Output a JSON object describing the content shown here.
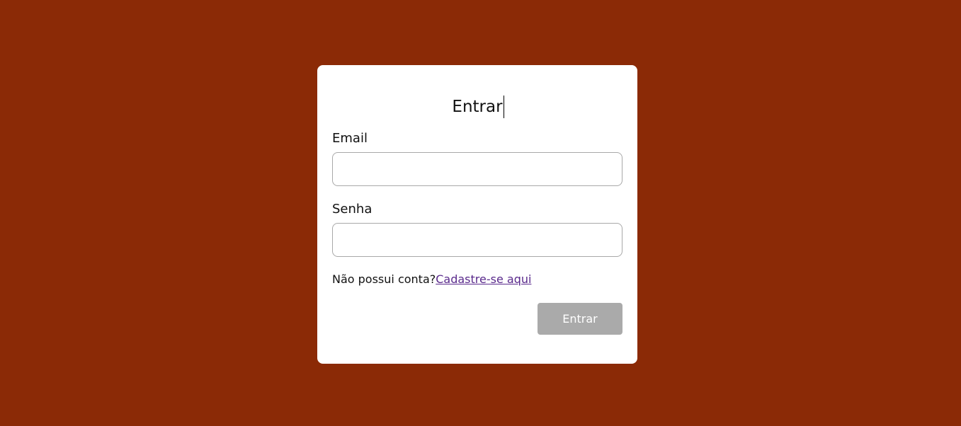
{
  "login": {
    "title": "Entrar",
    "email_label": "Email",
    "email_value": "",
    "password_label": "Senha",
    "password_value": "",
    "signup_prompt": "Não possui conta?",
    "signup_link": "Cadastre-se aqui",
    "submit_label": "Entrar"
  },
  "colors": {
    "background": "#8b2a06",
    "card": "#ffffff",
    "submit_button": "#aaaaaa",
    "link": "#5a2a8c"
  }
}
